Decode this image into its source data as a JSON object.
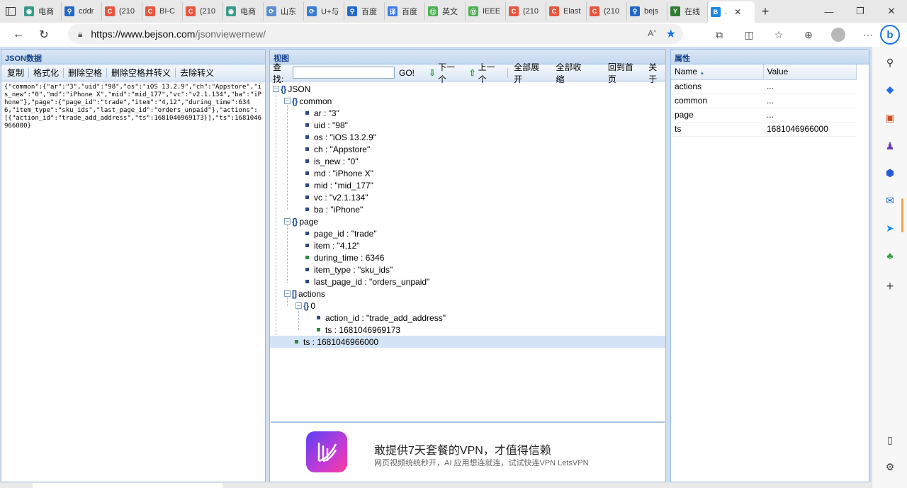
{
  "browser": {
    "tabs": [
      {
        "label": "电商",
        "icon": "globe-icon",
        "color": "#3a9a8a"
      },
      {
        "label": "cddr",
        "icon": "search-icon",
        "color": "#2468c6"
      },
      {
        "label": "(210",
        "icon": "csdn-icon",
        "color": "#e8553f"
      },
      {
        "label": "BI-C",
        "icon": "csdn-icon",
        "color": "#e8553f"
      },
      {
        "label": "(210",
        "icon": "csdn-icon",
        "color": "#e8553f"
      },
      {
        "label": "电商",
        "icon": "globe-icon",
        "color": "#3a9a8a"
      },
      {
        "label": "山东",
        "icon": "link-icon",
        "color": "#5a8fd0"
      },
      {
        "label": "U+与",
        "icon": "link-icon",
        "color": "#3a7bd5"
      },
      {
        "label": "百度",
        "icon": "search-icon",
        "color": "#2468c6"
      },
      {
        "label": "百度",
        "icon": "translate-icon",
        "color": "#3b7ae8"
      },
      {
        "label": "英文",
        "icon": "idiom-icon",
        "color": "#4caf50"
      },
      {
        "label": "IEEE",
        "icon": "idiom-icon",
        "color": "#4caf50"
      },
      {
        "label": "(210",
        "icon": "csdn-icon",
        "color": "#e8553f"
      },
      {
        "label": "Elast",
        "icon": "csdn-icon",
        "color": "#e8553f"
      },
      {
        "label": "(210",
        "icon": "csdn-icon",
        "color": "#e8553f"
      },
      {
        "label": "bejs",
        "icon": "search-icon",
        "color": "#2468c6"
      },
      {
        "label": "在线",
        "icon": "y-icon",
        "color": "#2e7d32"
      },
      {
        "label": ".",
        "icon": "bejson-icon",
        "color": "#1e88e5"
      }
    ],
    "url_host": "https://www.bejson.com",
    "url_path": "/jsonviewernew/"
  },
  "left_panel": {
    "title": "JSON数据",
    "toolbar": [
      "复制",
      "格式化",
      "删除空格",
      "删除空格并转义",
      "去除转义"
    ],
    "json_text": "{\"common\":{\"ar\":\"3\",\"uid\":\"98\",\"os\":\"iOS 13.2.9\",\"ch\":\"Appstore\",\"is_new\":\"0\",\"md\":\"iPhone X\",\"mid\":\"mid_177\",\"vc\":\"v2.1.134\",\"ba\":\"iPhone\"},\"page\":{\"page_id\":\"trade\",\"item\":\"4,12\",\"during_time\":6346,\"item_type\":\"sku_ids\",\"last_page_id\":\"orders_unpaid\"},\"actions\":[{\"action_id\":\"trade_add_address\",\"ts\":1681046969173}],\"ts\":1681046966000}"
  },
  "middle_panel": {
    "title": "视图",
    "search_label": "查找:",
    "go_label": "GO!",
    "next_label": "下一个",
    "prev_label": "上一个",
    "expand_all": "全部展开",
    "collapse_all": "全部收缩",
    "home": "回到首页",
    "about": "关于",
    "tree": {
      "root": "JSON",
      "common": {
        "label": "common",
        "items": [
          "ar : \"3\"",
          "uid : \"98\"",
          "os : \"iOS 13.2.9\"",
          "ch : \"Appstore\"",
          "is_new : \"0\"",
          "md : \"iPhone X\"",
          "mid : \"mid_177\"",
          "vc : \"v2.1.134\"",
          "ba : \"iPhone\""
        ]
      },
      "page": {
        "label": "page",
        "items": [
          "page_id : \"trade\"",
          "item : \"4,12\"",
          "during_time : 6346",
          "item_type : \"sku_ids\"",
          "last_page_id : \"orders_unpaid\""
        ]
      },
      "actions": {
        "label": "actions",
        "index": "0",
        "items": [
          "action_id : \"trade_add_address\"",
          "ts : 1681046969173"
        ]
      },
      "ts": "ts : 1681046966000"
    },
    "ad": {
      "title": "敢提供7天套餐的VPN，才值得信赖",
      "subtitle": "网页视频统统秒开，AI 应用想连就连，试试快连VPN LetsVPN"
    }
  },
  "right_panel": {
    "title": "属性",
    "col_name": "Name",
    "col_value": "Value",
    "rows": [
      {
        "name": "actions",
        "value": "..."
      },
      {
        "name": "common",
        "value": "..."
      },
      {
        "name": "page",
        "value": "..."
      },
      {
        "name": "ts",
        "value": "1681046966000"
      }
    ]
  }
}
